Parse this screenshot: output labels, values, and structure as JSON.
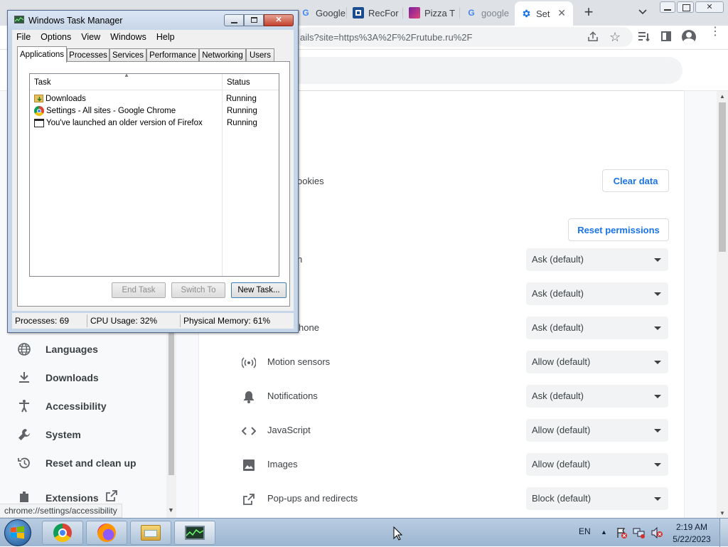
{
  "browser": {
    "tabs": [
      {
        "label": "Google",
        "favicon": "google-icon"
      },
      {
        "label": "RecFor",
        "favicon": "recfor-icon"
      },
      {
        "label": "Pizza T",
        "favicon": "pizza-icon"
      },
      {
        "label": "google",
        "favicon": "google-icon"
      },
      {
        "label": "Set",
        "favicon": "gear-icon",
        "active": true
      }
    ],
    "new_tab": "+",
    "address": "ails?site=https%3A%2F%2Frutube.ru%2F",
    "status_url": "chrome://settings/accessibility",
    "accent_color": "#1a73e8"
  },
  "sidebar": {
    "items": [
      {
        "label": "Languages",
        "icon": "globe-icon"
      },
      {
        "label": "Downloads",
        "icon": "download-icon"
      },
      {
        "label": "Accessibility",
        "icon": "accessibility-icon"
      },
      {
        "label": "System",
        "icon": "wrench-icon"
      },
      {
        "label": "Reset and clean up",
        "icon": "history-icon"
      },
      {
        "label": "Extensions",
        "icon": "external-link-icon"
      }
    ]
  },
  "site_settings": {
    "cookies_label_partial": "ookies",
    "clear_data": "Clear data",
    "reset_permissions": "Reset permissions",
    "permissions": [
      {
        "label": "n",
        "value": "Ask (default)",
        "icon": ""
      },
      {
        "label": "",
        "value": "Ask (default)",
        "icon": ""
      },
      {
        "label": "hone",
        "value": "Ask (default)",
        "icon": ""
      },
      {
        "label": "Motion sensors",
        "value": "Allow (default)",
        "icon": "sensors-icon"
      },
      {
        "label": "Notifications",
        "value": "Ask (default)",
        "icon": "bell-icon"
      },
      {
        "label": "JavaScript",
        "value": "Allow (default)",
        "icon": "code-icon"
      },
      {
        "label": "Images",
        "value": "Allow (default)",
        "icon": "image-icon"
      },
      {
        "label": "Pop-ups and redirects",
        "value": "Block (default)",
        "icon": "external-link-icon"
      }
    ]
  },
  "task_manager": {
    "title": "Windows Task Manager",
    "menu": [
      "File",
      "Options",
      "View",
      "Windows",
      "Help"
    ],
    "tabs": [
      "Applications",
      "Processes",
      "Services",
      "Performance",
      "Networking",
      "Users"
    ],
    "active_tab": "Applications",
    "columns": [
      "Task",
      "Status"
    ],
    "rows": [
      {
        "task": "Downloads",
        "status": "Running",
        "icon": "folder-icon"
      },
      {
        "task": "Settings - All sites - Google Chrome",
        "status": "Running",
        "icon": "chrome-icon"
      },
      {
        "task": "You've launched an older version of Firefox",
        "status": "Running",
        "icon": "window-icon"
      }
    ],
    "buttons": {
      "end_task": "End Task",
      "switch_to": "Switch To",
      "new_task": "New Task..."
    },
    "status": {
      "processes": "Processes: 69",
      "cpu": "CPU Usage: 32%",
      "memory": "Physical Memory: 61%"
    }
  },
  "taskbar": {
    "apps": [
      "chrome-icon",
      "firefox-icon",
      "file-explorer-icon",
      "task-manager-icon"
    ],
    "lang": "EN",
    "time": "2:19 AM",
    "date": "5/22/2023"
  }
}
